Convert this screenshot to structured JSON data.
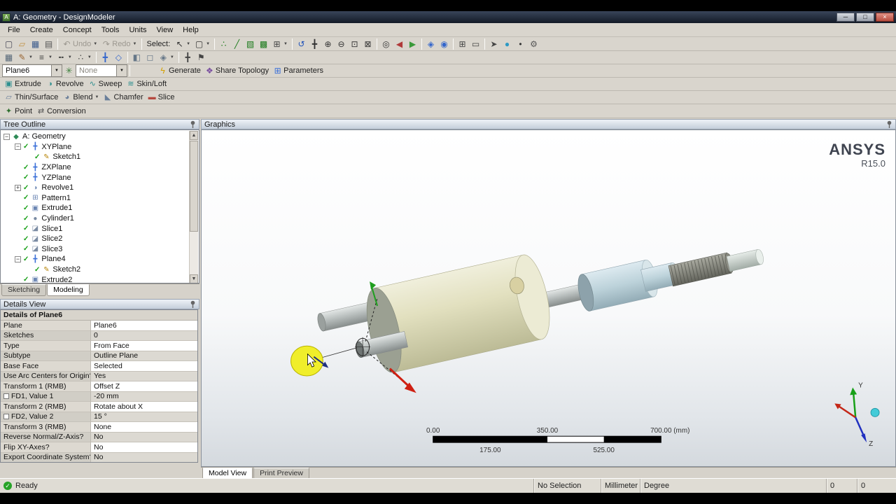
{
  "window": {
    "title": "A: Geometry - DesignModeler",
    "controls": {
      "minimize": "─",
      "maximize": "□",
      "close": "×"
    }
  },
  "menubar": {
    "items": [
      "File",
      "Create",
      "Concept",
      "Tools",
      "Units",
      "View",
      "Help"
    ]
  },
  "toolbar_standard": {
    "items": [
      {
        "type": "btn",
        "name": "file-new-button",
        "glyph": "▢",
        "color": "#445"
      },
      {
        "type": "btn",
        "name": "open-button",
        "glyph": "▱",
        "color": "#c09040"
      },
      {
        "type": "btn",
        "name": "save-button",
        "glyph": "▦",
        "color": "#3a5a8c"
      },
      {
        "type": "btn",
        "name": "print-button",
        "glyph": "▤",
        "color": "#555"
      },
      {
        "type": "sep"
      },
      {
        "type": "btn",
        "name": "undo-button",
        "glyph": "↶",
        "label": "Undo",
        "dropdown": true,
        "disabled": true
      },
      {
        "type": "btn",
        "name": "redo-button",
        "glyph": "↷",
        "label": "Redo",
        "dropdown": true,
        "disabled": true
      },
      {
        "type": "sep"
      },
      {
        "type": "label",
        "name": "select-label",
        "label": "Select:"
      },
      {
        "type": "btn",
        "name": "select-mode-button",
        "glyph": "↖",
        "color": "#333",
        "dropdown": true
      },
      {
        "type": "btn",
        "name": "box-select-button",
        "glyph": "▢",
        "color": "#333",
        "dropdown": true
      },
      {
        "type": "sep"
      },
      {
        "type": "btn",
        "name": "filter-vertices-button",
        "glyph": "∴",
        "color": "#1b7a1b"
      },
      {
        "type": "btn",
        "name": "filter-edges-button",
        "glyph": "╱",
        "color": "#1b7a1b"
      },
      {
        "type": "btn",
        "name": "filter-faces-button",
        "glyph": "▧",
        "color": "#1b7a1b"
      },
      {
        "type": "btn",
        "name": "filter-bodies-button",
        "glyph": "▩",
        "color": "#1b7a1b"
      },
      {
        "type": "btn",
        "name": "adjacency-select-button",
        "glyph": "⊞",
        "color": "#444",
        "dropdown": true
      },
      {
        "type": "sep"
      },
      {
        "type": "btn",
        "name": "rotate-view-button",
        "glyph": "↺",
        "color": "#2255bb"
      },
      {
        "type": "btn",
        "name": "pan-button",
        "glyph": "╋",
        "color": "#333"
      },
      {
        "type": "btn",
        "name": "zoom-in-button",
        "glyph": "⊕",
        "color": "#333"
      },
      {
        "type": "btn",
        "name": "zoom-out-button",
        "glyph": "⊖",
        "color": "#333"
      },
      {
        "type": "btn",
        "name": "box-zoom-button",
        "glyph": "⊡",
        "color": "#333"
      },
      {
        "type": "btn",
        "name": "zoom-fit-button",
        "glyph": "⊠",
        "color": "#333"
      },
      {
        "type": "sep"
      },
      {
        "type": "btn",
        "name": "magnifier-button",
        "glyph": "◎",
        "color": "#333"
      },
      {
        "type": "btn",
        "name": "previous-view-button",
        "glyph": "◀",
        "color": "#b03a3a"
      },
      {
        "type": "btn",
        "name": "next-view-button",
        "glyph": "▶",
        "color": "#3a9a3a"
      },
      {
        "type": "sep"
      },
      {
        "type": "btn",
        "name": "isometric-view-button",
        "glyph": "◈",
        "color": "#3366cc"
      },
      {
        "type": "btn",
        "name": "look-at-button",
        "glyph": "◉",
        "color": "#3366cc"
      },
      {
        "type": "sep"
      },
      {
        "type": "btn",
        "name": "viewports-button",
        "glyph": "⊞",
        "color": "#444"
      },
      {
        "type": "btn",
        "name": "ruler-toggle-button",
        "glyph": "▭",
        "color": "#444"
      },
      {
        "type": "sep"
      },
      {
        "type": "btn",
        "name": "selection-cursor-button",
        "glyph": "➤",
        "color": "#444"
      },
      {
        "type": "btn",
        "name": "sphere-display-button",
        "glyph": "●",
        "color": "#2e9ac4"
      },
      {
        "type": "btn",
        "name": "point-display-button",
        "glyph": "•",
        "color": "#333"
      },
      {
        "type": "btn",
        "name": "settings-button",
        "glyph": "⚙",
        "color": "#555"
      }
    ]
  },
  "toolbar_display": {
    "items": [
      {
        "type": "btn",
        "name": "display-plane-button",
        "glyph": "▦",
        "color": "#556677"
      },
      {
        "type": "btn",
        "name": "edge-color-button",
        "glyph": "✎",
        "color": "#996633",
        "dropdown": true
      },
      {
        "type": "btn",
        "name": "line-weight-button",
        "glyph": "≡",
        "color": "#444",
        "dropdown": true
      },
      {
        "type": "btn",
        "name": "line-style-button",
        "glyph": "╍",
        "color": "#444",
        "dropdown": true
      },
      {
        "type": "btn",
        "name": "point-style-button",
        "glyph": "∴",
        "color": "#444",
        "dropdown": true
      },
      {
        "type": "sep"
      },
      {
        "type": "btn",
        "name": "triad-display-button",
        "glyph": "╋",
        "color": "#3366cc"
      },
      {
        "type": "btn",
        "name": "plane-display-button",
        "glyph": "◇",
        "color": "#3366cc"
      },
      {
        "type": "sep"
      },
      {
        "type": "btn",
        "name": "shaded-view-button",
        "glyph": "◧",
        "color": "#667788"
      },
      {
        "type": "btn",
        "name": "wireframe-view-button",
        "glyph": "◻",
        "color": "#667788"
      },
      {
        "type": "btn",
        "name": "edge-display-button",
        "glyph": "◈",
        "color": "#667788",
        "dropdown": true
      },
      {
        "type": "sep"
      },
      {
        "type": "btn",
        "name": "vertices-display-button",
        "glyph": "╋",
        "color": "#444"
      },
      {
        "type": "btn",
        "name": "flag-button",
        "glyph": "⚑",
        "color": "#444"
      }
    ]
  },
  "toolbar_context": {
    "plane_combo": "Plane6",
    "filter_combo": "None",
    "generate_label": "Generate",
    "share_label": "Share Topology",
    "parameters_label": "Parameters"
  },
  "toolbar_features": {
    "row1": [
      {
        "type": "btn",
        "name": "extrude-button",
        "label": "Extrude",
        "glyph": "▣",
        "color": "#2e8f8f"
      },
      {
        "type": "btn",
        "name": "revolve-button",
        "label": "Revolve",
        "glyph": "◑",
        "color": "#2e8f8f"
      },
      {
        "type": "btn",
        "name": "sweep-button",
        "label": "Sweep",
        "glyph": "∿",
        "color": "#2e8f8f"
      },
      {
        "type": "btn",
        "name": "skin-loft-button",
        "label": "Skin/Loft",
        "glyph": "≋",
        "color": "#2e8f8f"
      }
    ],
    "row2": [
      {
        "type": "btn",
        "name": "thin-surface-button",
        "label": "Thin/Surface",
        "glyph": "▱",
        "color": "#6a7f9a"
      },
      {
        "type": "btn",
        "name": "blend-button",
        "label": "Blend",
        "glyph": "◕",
        "color": "#6a7f9a",
        "dropdown": true
      },
      {
        "type": "btn",
        "name": "chamfer-button",
        "label": "Chamfer",
        "glyph": "◣",
        "color": "#6a7f9a"
      },
      {
        "type": "btn",
        "name": "slice-button",
        "label": "Slice",
        "glyph": "▬",
        "color": "#b5493f"
      }
    ],
    "row3": [
      {
        "type": "btn",
        "name": "point-button",
        "label": "Point",
        "glyph": "✦",
        "color": "#2e6f2e"
      },
      {
        "type": "btn",
        "name": "conversion-button",
        "label": "Conversion",
        "glyph": "⇄",
        "color": "#555"
      }
    ]
  },
  "tree": {
    "header": "Tree Outline",
    "icons": {
      "geometry": {
        "glyph": "◆",
        "color": "#2e8b57"
      },
      "plane": {
        "glyph": "╋",
        "color": "#3a6fd8"
      },
      "sketch": {
        "glyph": "✎",
        "color": "#b8860b"
      },
      "revolve": {
        "glyph": "◑",
        "color": "#6b86b3"
      },
      "pattern": {
        "glyph": "⊞",
        "color": "#6b86b3"
      },
      "extrude": {
        "glyph": "▣",
        "color": "#6b86b3"
      },
      "cylinder": {
        "glyph": "●",
        "color": "#7a8ba3"
      },
      "slice": {
        "glyph": "◪",
        "color": "#7a8ba3"
      }
    },
    "items": [
      {
        "label": "A: Geometry",
        "level": 0,
        "expander": "minus",
        "icon": "geometry",
        "checked": false
      },
      {
        "label": "XYPlane",
        "level": 1,
        "expander": "minus",
        "icon": "plane",
        "checked": true
      },
      {
        "label": "Sketch1",
        "level": 2,
        "expander": null,
        "icon": "sketch",
        "checked": true
      },
      {
        "label": "ZXPlane",
        "level": 1,
        "expander": null,
        "icon": "plane",
        "checked": true
      },
      {
        "label": "YZPlane",
        "level": 1,
        "expander": null,
        "icon": "plane",
        "checked": true
      },
      {
        "label": "Revolve1",
        "level": 1,
        "expander": "plus",
        "icon": "revolve",
        "checked": true
      },
      {
        "label": "Pattern1",
        "level": 1,
        "expander": null,
        "icon": "pattern",
        "checked": true
      },
      {
        "label": "Extrude1",
        "level": 1,
        "expander": null,
        "icon": "extrude",
        "checked": true
      },
      {
        "label": "Cylinder1",
        "level": 1,
        "expander": null,
        "icon": "cylinder",
        "checked": true
      },
      {
        "label": "Slice1",
        "level": 1,
        "expander": null,
        "icon": "slice",
        "checked": true
      },
      {
        "label": "Slice2",
        "level": 1,
        "expander": null,
        "icon": "slice",
        "checked": true
      },
      {
        "label": "Slice3",
        "level": 1,
        "expander": null,
        "icon": "slice",
        "checked": true
      },
      {
        "label": "Plane4",
        "level": 1,
        "expander": "minus",
        "icon": "plane",
        "checked": true
      },
      {
        "label": "Sketch2",
        "level": 2,
        "expander": null,
        "icon": "sketch",
        "checked": true
      },
      {
        "label": "Extrude2",
        "level": 1,
        "expander": null,
        "icon": "extrude",
        "checked": true
      }
    ],
    "tabs": [
      "Sketching",
      "Modeling"
    ],
    "active_tab": "Modeling"
  },
  "details_view": {
    "header": "Details View",
    "title": "Details of Plane6",
    "rows": [
      {
        "label": "Plane",
        "value": "Plane6"
      },
      {
        "label": "Sketches",
        "value": "0"
      },
      {
        "label": "Type",
        "value": "From Face"
      },
      {
        "label": "Subtype",
        "value": "Outline Plane"
      },
      {
        "label": "Base Face",
        "value": "Selected"
      },
      {
        "label": "Use Arc Centers for Origin?",
        "value": "Yes"
      },
      {
        "label": "Transform 1 (RMB)",
        "value": "Offset Z"
      },
      {
        "label": "FD1, Value 1",
        "value": "-20 mm",
        "checkbox": true
      },
      {
        "label": "Transform 2 (RMB)",
        "value": "Rotate about X"
      },
      {
        "label": "FD2, Value 2",
        "value": "15 °",
        "checkbox": true
      },
      {
        "label": "Transform 3 (RMB)",
        "value": "None"
      },
      {
        "label": "Reverse Normal/Z-Axis?",
        "value": "No"
      },
      {
        "label": "Flip XY-Axes?",
        "value": "No"
      },
      {
        "label": "Export Coordinate System?",
        "value": "No"
      }
    ]
  },
  "graphics": {
    "header": "Graphics",
    "brand1": "ANSYS",
    "brand2": "R15.0",
    "ruler": {
      "t0": "0.00",
      "t1": "350.00",
      "t2": "700.00 (mm)",
      "b0": "175.00",
      "b1": "525.00"
    },
    "triad_y": "Y",
    "triad_z": "Z",
    "tabs": [
      "Model View",
      "Print Preview"
    ],
    "active_tab": "Model View"
  },
  "statusbar": {
    "ready": "Ready",
    "selection": "No Selection",
    "length_unit": "Millimeter",
    "angle_unit": "Degree",
    "x": "0",
    "y": "0"
  }
}
